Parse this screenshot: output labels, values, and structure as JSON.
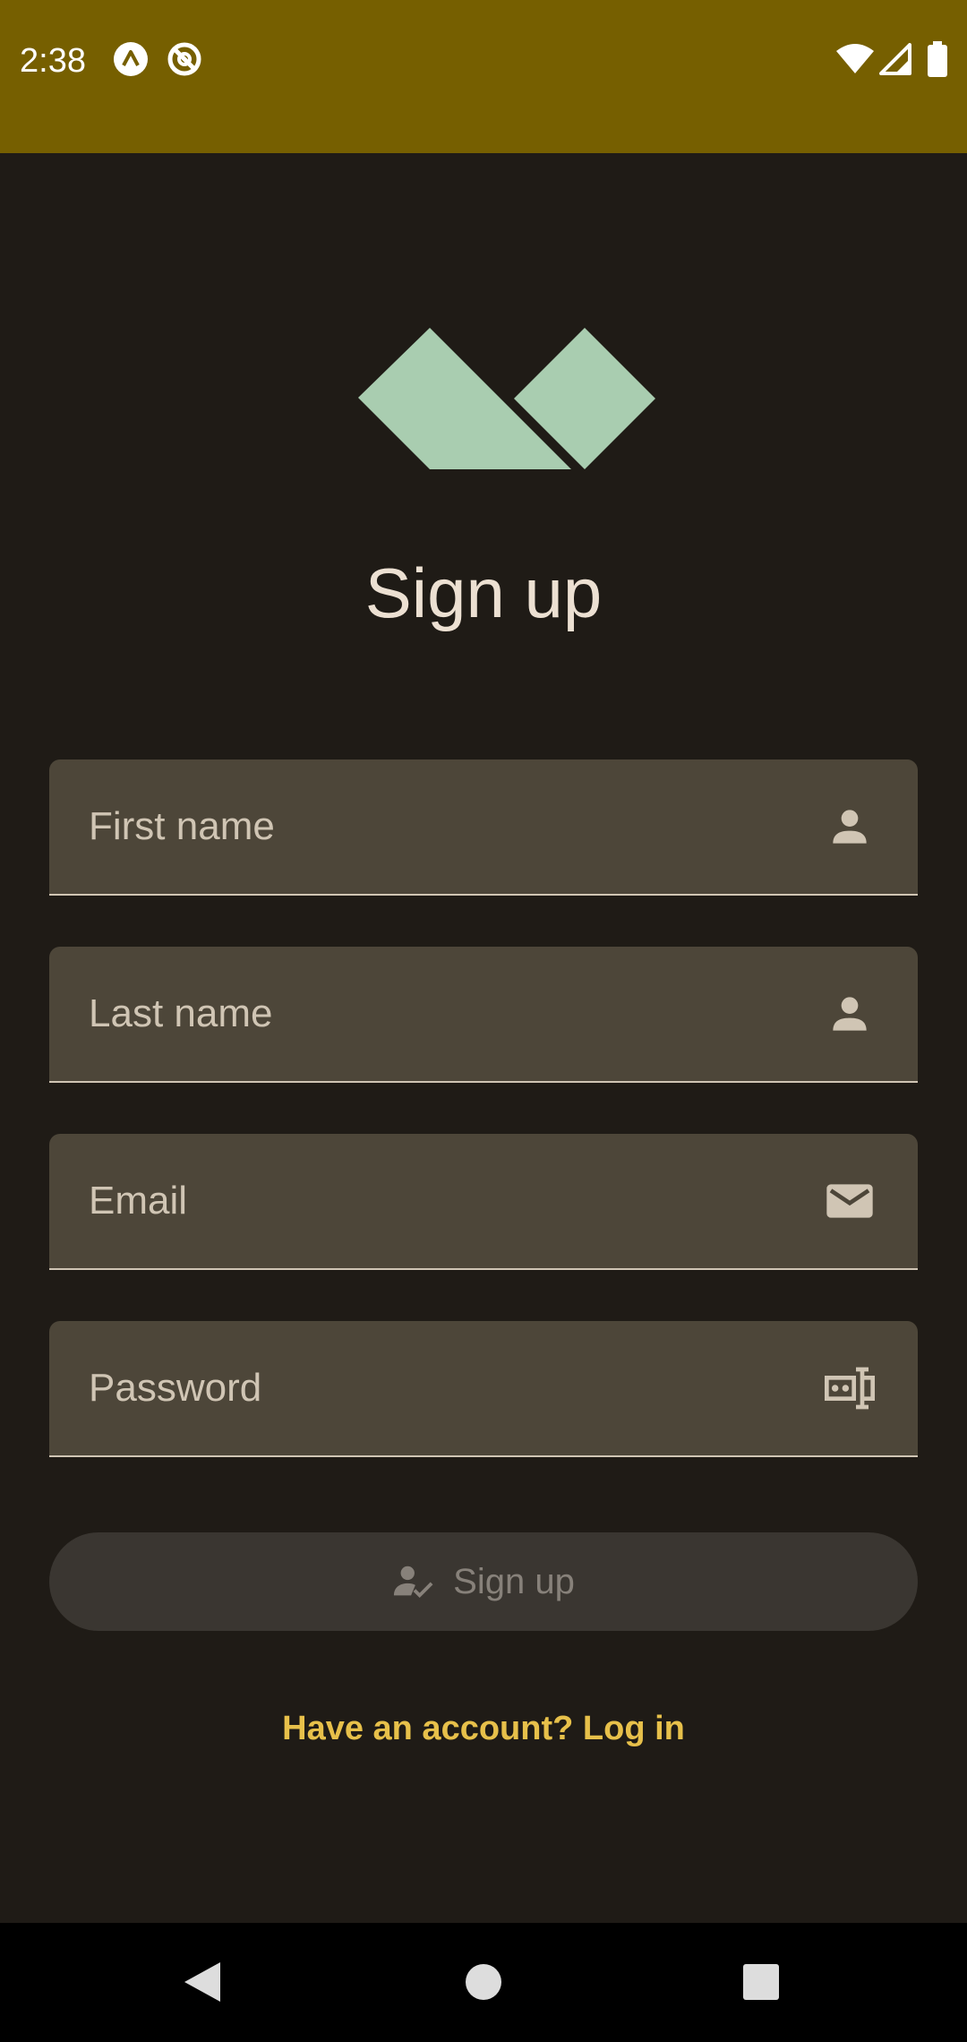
{
  "status_bar": {
    "time": "2:38",
    "app_icons": [
      "expo-icon",
      "no-tracking-icon"
    ],
    "right_icons": [
      "wifi-icon",
      "signal-icon",
      "battery-icon"
    ]
  },
  "title": "Sign up",
  "fields": {
    "first_name": {
      "label": "First name",
      "icon": "person-icon"
    },
    "last_name": {
      "label": "Last name",
      "icon": "person-icon"
    },
    "email": {
      "label": "Email",
      "icon": "mail-icon"
    },
    "password": {
      "label": "Password",
      "icon": "password-icon"
    }
  },
  "signup_button": {
    "label": "Sign up",
    "icon": "person-check-icon",
    "enabled": false
  },
  "login_link": "Have an account? Log in",
  "nav": [
    "back-icon",
    "home-icon",
    "recents-icon"
  ],
  "colors": {
    "status_bar": "#765f00",
    "background": "#1f1b16",
    "logo": "#a9cdb0",
    "field_bg": "#4d4639",
    "link": "#e7c04a"
  }
}
